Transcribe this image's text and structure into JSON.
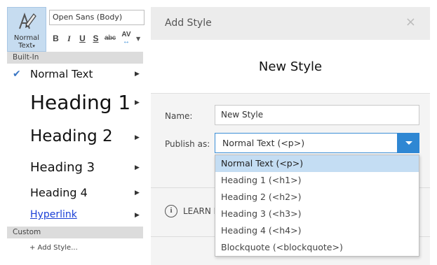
{
  "toolbar": {
    "normal_text_button": "Normal\nText",
    "font_name": "Open Sans (Body)",
    "format_buttons": [
      "B",
      "I",
      "U",
      "S",
      "abc",
      "AV"
    ]
  },
  "styles_panel": {
    "builtin_header": "Built-In",
    "items": [
      {
        "label": "Normal Text",
        "checked": true
      },
      {
        "label": "Heading 1"
      },
      {
        "label": "Heading 2"
      },
      {
        "label": "Heading 3"
      },
      {
        "label": "Heading 4"
      },
      {
        "label": "Hyperlink"
      }
    ],
    "custom_header": "Custom",
    "add_style": "+ Add Style..."
  },
  "dialog": {
    "title": "Add Style",
    "close": "×",
    "preview_text": "New Style",
    "name_label": "Name:",
    "name_value": "New Style",
    "publish_label": "Publish as:",
    "publish_value": "Normal Text (<p>)",
    "learn_more": "LEARN M"
  },
  "dropdown": {
    "options": [
      "Normal Text (<p>)",
      "Heading 1 (<h1>)",
      "Heading 2 (<h2>)",
      "Heading 3 (<h3>)",
      "Heading 4 (<h4>)",
      "Blockquote (<blockquote>)"
    ],
    "selected_index": 0
  },
  "colors": {
    "accent": "#2f87d3",
    "selected_bg": "#c4ddf3",
    "button_bg": "#c6dcf0",
    "hyperlink": "#1a3fd6"
  }
}
